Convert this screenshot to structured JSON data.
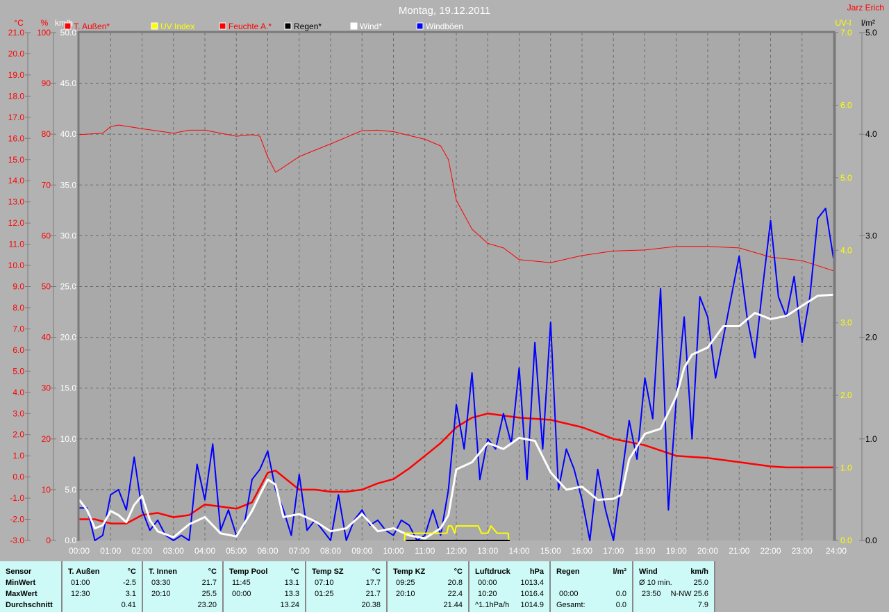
{
  "title": "Montag, 19.12.2011",
  "author": "Jarz Erich",
  "axis_units": {
    "temp": "°C",
    "hum": "%",
    "wind": "km/h",
    "uv": "UV-I",
    "rain": "l/m²"
  },
  "legend": [
    {
      "label": "T. Außen*",
      "color": "#ff0000",
      "text_color": "#ff0000"
    },
    {
      "label": "UV Index",
      "color": "#ffff00",
      "text_color": "#ffff00"
    },
    {
      "label": "Feuchte A.*",
      "color": "#ff0000",
      "text_color": "#ff0000"
    },
    {
      "label": "Regen*",
      "color": "#000000",
      "text_color": "#000000"
    },
    {
      "label": "Wind*",
      "color": "#ffffff",
      "text_color": "#ffffff"
    },
    {
      "label": "Windböen",
      "color": "#0000ff",
      "text_color": "#ffffff"
    }
  ],
  "chart_data": {
    "type": "line",
    "title": "Montag, 19.12.2011",
    "xlabel": "",
    "xlim": [
      0,
      24
    ],
    "x_ticks": [
      "00:00",
      "01:00",
      "02:00",
      "03:00",
      "04:00",
      "05:00",
      "06:00",
      "07:00",
      "08:00",
      "09:00",
      "10:00",
      "11:00",
      "12:00",
      "13:00",
      "14:00",
      "15:00",
      "16:00",
      "17:00",
      "18:00",
      "19:00",
      "20:00",
      "21:00",
      "22:00",
      "23:00",
      "24:00"
    ],
    "axes": {
      "temp": {
        "unit": "°C",
        "range": [
          -3,
          21
        ],
        "step": 1,
        "color": "#ff0000"
      },
      "hum": {
        "unit": "%",
        "range": [
          0,
          100
        ],
        "step": 10,
        "color": "#ff0000"
      },
      "wind": {
        "unit": "km/h",
        "range": [
          0,
          50
        ],
        "step": 5,
        "color": "#ffffff"
      },
      "uv": {
        "unit": "UV-I",
        "range": [
          0,
          7
        ],
        "step": 1,
        "color": "#ffff00"
      },
      "rain": {
        "unit": "l/m²",
        "range": [
          0,
          5
        ],
        "step": 1,
        "color": "#000000"
      }
    },
    "grid": true,
    "legend_position": "top",
    "series": [
      {
        "name": "Feuchte A.*",
        "axis": "hum",
        "color": "#ff0000",
        "width": 1,
        "t": [
          0,
          0.75,
          1,
          1.25,
          2,
          3,
          3.5,
          4,
          5,
          5.5,
          5.75,
          6,
          6.25,
          6.5,
          7,
          8,
          9,
          9.5,
          10,
          11,
          11.5,
          11.75,
          12,
          12.5,
          13,
          13.5,
          14,
          15,
          16,
          17,
          18,
          19,
          20,
          21,
          22,
          23,
          24
        ],
        "values": [
          79.9,
          80.2,
          81.5,
          81.8,
          81.1,
          80.2,
          80.8,
          80.8,
          79.6,
          79.9,
          79.6,
          75.5,
          72.5,
          73.5,
          75.6,
          78.1,
          80.7,
          80.8,
          80.5,
          79.0,
          77.7,
          75,
          67,
          61.3,
          58.5,
          57.6,
          55.3,
          54.7,
          56.1,
          57.0,
          57.2,
          57.9,
          57.9,
          57.6,
          55.8,
          55.1,
          53.1
        ]
      },
      {
        "name": "T. Außen*",
        "axis": "temp",
        "color": "#ff0000",
        "width": 2.5,
        "t": [
          0,
          0.5,
          1,
          1.5,
          2,
          2.5,
          3,
          3.5,
          4,
          4.5,
          5,
          5.5,
          6,
          6.25,
          6.5,
          7,
          7.5,
          8,
          8.5,
          9,
          9.5,
          10,
          10.5,
          11,
          11.5,
          12,
          12.5,
          13,
          13.5,
          14,
          15,
          16,
          17,
          18,
          19,
          20,
          21,
          22,
          22.5,
          23,
          24
        ],
        "values": [
          -2.0,
          -2.0,
          -2.2,
          -2.2,
          -1.8,
          -1.7,
          -1.9,
          -1.8,
          -1.3,
          -1.4,
          -1.5,
          -1.2,
          0.2,
          0.3,
          0.0,
          -0.6,
          -0.6,
          -0.7,
          -0.7,
          -0.6,
          -0.3,
          -0.1,
          0.4,
          1.0,
          1.6,
          2.35,
          2.8,
          3.0,
          2.9,
          2.8,
          2.7,
          2.35,
          1.8,
          1.5,
          1.0,
          0.9,
          0.7,
          0.5,
          0.45,
          0.45,
          0.45
        ]
      },
      {
        "name": "Windböen",
        "axis": "wind",
        "color": "#0000ff",
        "width": 2,
        "t": [
          0,
          0.25,
          0.5,
          0.75,
          1,
          1.25,
          1.5,
          1.75,
          2,
          2.25,
          2.5,
          2.75,
          3,
          3.25,
          3.5,
          3.75,
          4,
          4.25,
          4.5,
          4.75,
          5,
          5.25,
          5.5,
          5.75,
          6,
          6.25,
          6.5,
          6.75,
          7,
          7.25,
          7.5,
          7.75,
          8,
          8.25,
          8.5,
          8.75,
          9,
          9.25,
          9.5,
          9.75,
          10,
          10.25,
          10.5,
          10.75,
          11,
          11.25,
          11.5,
          11.75,
          12,
          12.25,
          12.5,
          12.75,
          13,
          13.25,
          13.5,
          13.75,
          14,
          14.25,
          14.5,
          14.75,
          15,
          15.25,
          15.5,
          15.75,
          16,
          16.25,
          16.5,
          16.75,
          17,
          17.25,
          17.5,
          17.75,
          18,
          18.25,
          18.5,
          18.75,
          19,
          19.25,
          19.5,
          19.75,
          20,
          20.25,
          20.5,
          20.75,
          21,
          21.25,
          21.5,
          21.75,
          22,
          22.25,
          22.5,
          22.75,
          23,
          23.25,
          23.5,
          23.75,
          24
        ],
        "values": [
          3.2,
          3.2,
          0,
          0.5,
          4.5,
          5,
          3,
          8.2,
          3,
          1,
          2,
          0.5,
          0,
          0.5,
          0,
          7.5,
          4,
          9.5,
          1,
          3,
          0.5,
          1.5,
          6,
          7,
          8.8,
          5,
          3,
          0.5,
          6.5,
          1,
          2,
          1,
          0,
          4.5,
          0,
          2,
          3,
          1.5,
          2,
          1,
          0.5,
          2,
          1.5,
          0,
          0.5,
          3,
          0.5,
          5,
          13.4,
          9,
          16.5,
          6,
          10,
          9,
          12.5,
          9.5,
          17,
          6,
          19.5,
          9,
          21.5,
          5,
          9,
          7,
          4,
          0,
          7,
          3,
          0,
          6,
          11.8,
          8,
          16,
          12,
          24.8,
          3,
          14,
          22,
          10,
          24,
          22,
          16,
          20,
          24,
          28,
          22,
          18,
          25,
          31.5,
          24,
          22,
          26,
          19.5,
          24,
          31.7,
          32.7,
          27.8
        ]
      },
      {
        "name": "Wind*",
        "axis": "wind",
        "color": "#ffffff",
        "width": 3,
        "t": [
          0,
          0.25,
          0.5,
          0.75,
          1,
          1.25,
          1.5,
          1.75,
          2,
          2.25,
          2.5,
          3,
          3.5,
          4,
          4.5,
          5,
          5.5,
          5.75,
          6,
          6.25,
          6.5,
          7,
          7.5,
          8,
          8.5,
          9,
          9.5,
          10,
          10.5,
          11,
          11.5,
          11.75,
          12,
          12.5,
          13,
          13.5,
          14,
          14.5,
          15,
          15.5,
          16,
          16.5,
          17,
          17.25,
          17.5,
          18,
          18.5,
          19,
          19.25,
          19.5,
          20,
          20.5,
          21,
          21.5,
          22,
          22.5,
          23,
          23.5,
          24
        ],
        "values": [
          4.0,
          3.0,
          1.2,
          1.5,
          2.9,
          2.5,
          1.8,
          3.5,
          4.4,
          2.0,
          0.9,
          0.3,
          1.6,
          2.3,
          0.7,
          0.4,
          2.9,
          4.5,
          6.0,
          5.5,
          2.3,
          2.6,
          1.9,
          0.9,
          1.2,
          2.6,
          0.9,
          1.2,
          0.5,
          0.2,
          1.2,
          2.5,
          7.0,
          7.7,
          9.6,
          9.0,
          10.1,
          9.8,
          6.7,
          5.0,
          5.3,
          4.0,
          4.1,
          4.5,
          8.0,
          10.5,
          11.0,
          14.2,
          17.0,
          18.3,
          19.0,
          21.1,
          21.1,
          22.4,
          21.8,
          22.1,
          23.1,
          24.1,
          24.2
        ]
      },
      {
        "name": "UV Index",
        "axis": "uv",
        "color": "#ffff00",
        "width": 2,
        "t": [
          10.35,
          10.37,
          11.5,
          11.7,
          11.75,
          11.85,
          11.95,
          12.0,
          12.2,
          12.7,
          12.8,
          13.0,
          13.1,
          13.3,
          13.4,
          13.65,
          13.67
        ],
        "values": [
          0,
          0.1,
          0.1,
          0.1,
          0.2,
          0.2,
          0.1,
          0.2,
          0.2,
          0.2,
          0.1,
          0.1,
          0.2,
          0.1,
          0.1,
          0.1,
          0
        ]
      },
      {
        "name": "Regen*",
        "axis": "rain",
        "color": "#000000",
        "width": 2,
        "t": [
          10.4,
          13.7
        ],
        "values": [
          0,
          0
        ]
      }
    ]
  },
  "table": {
    "columns": [
      {
        "name": "Sensor",
        "unit": "",
        "rows": [
          [
            "MinWert",
            ""
          ],
          [
            "MaxWert",
            ""
          ],
          [
            "Durchschnitt",
            ""
          ]
        ]
      },
      {
        "name": "T. Außen",
        "unit": "°C",
        "rows": [
          [
            "01:00",
            "-2.5"
          ],
          [
            "12:30",
            "3.1"
          ],
          [
            "",
            "0.41"
          ]
        ]
      },
      {
        "name": "T. Innen",
        "unit": "°C",
        "rows": [
          [
            "03:30",
            "21.7"
          ],
          [
            "20:10",
            "25.5"
          ],
          [
            "",
            "23.20"
          ]
        ]
      },
      {
        "name": "Temp Pool",
        "unit": "°C",
        "rows": [
          [
            "11:45",
            "13.1"
          ],
          [
            "00:00",
            "13.3"
          ],
          [
            "",
            "13.24"
          ]
        ]
      },
      {
        "name": "Temp SZ",
        "unit": "°C",
        "rows": [
          [
            "07:10",
            "17.7"
          ],
          [
            "01:25",
            "21.7"
          ],
          [
            "",
            "20.38"
          ]
        ]
      },
      {
        "name": "Temp KZ",
        "unit": "°C",
        "rows": [
          [
            "09:25",
            "20.8"
          ],
          [
            "20:10",
            "22.4"
          ],
          [
            "",
            "21.44"
          ]
        ]
      },
      {
        "name": "Luftdruck",
        "unit": "hPa",
        "rows": [
          [
            "00:00",
            "1013.4"
          ],
          [
            "10:20",
            "1016.4"
          ],
          [
            "^1.1hPa/h",
            "1014.9"
          ]
        ]
      },
      {
        "name": "Regen",
        "unit": "l/m²",
        "rows": [
          [
            "",
            ""
          ],
          [
            "00:00",
            "0.0"
          ],
          [
            "Gesamt:",
            "0.0"
          ]
        ]
      },
      {
        "name": "Wind",
        "unit": "km/h",
        "rows": [
          [
            "Ø 10 min.",
            "25.0"
          ],
          [
            "23:50",
            "N-NW 25.6"
          ],
          [
            "",
            "7.9"
          ]
        ]
      }
    ]
  }
}
